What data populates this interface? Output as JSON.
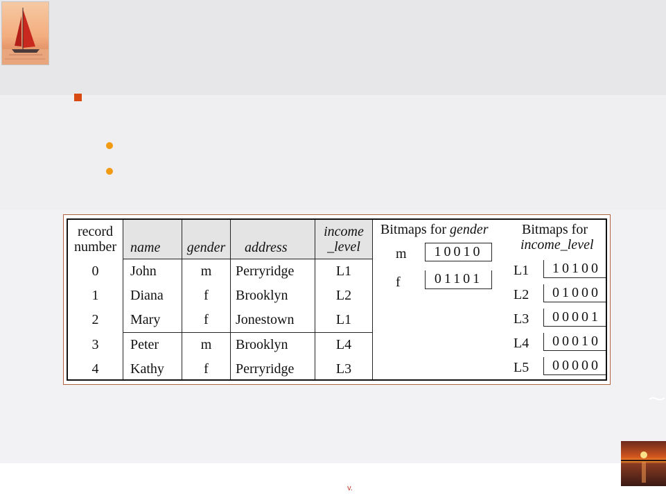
{
  "table": {
    "headers": {
      "record": "record",
      "record2": "number",
      "name": "name",
      "gender": "gender",
      "address": "address",
      "income": "income",
      "income2": "_level"
    },
    "rows": [
      {
        "record": "0",
        "name": "John",
        "gender": "m",
        "address": "Perryridge",
        "income_level": "L1"
      },
      {
        "record": "1",
        "name": "Diana",
        "gender": "f",
        "address": "Brooklyn",
        "income_level": "L2"
      },
      {
        "record": "2",
        "name": "Mary",
        "gender": "f",
        "address": "Jonestown",
        "income_level": "L1"
      },
      {
        "record": "3",
        "name": "Peter",
        "gender": "m",
        "address": "Brooklyn",
        "income_level": "L4"
      },
      {
        "record": "4",
        "name": "Kathy",
        "gender": "f",
        "address": "Perryridge",
        "income_level": "L3"
      }
    ]
  },
  "gender_bitmaps": {
    "title_prefix": "Bitmaps for ",
    "title_field": "gender",
    "items": [
      {
        "label": "m",
        "bits": "10010"
      },
      {
        "label": "f",
        "bits": "01101"
      }
    ]
  },
  "income_bitmaps": {
    "title_line1": "Bitmaps for",
    "title_line2": "income_level",
    "items": [
      {
        "label": "L1",
        "bits": "10100"
      },
      {
        "label": "L2",
        "bits": "01000"
      },
      {
        "label": "L3",
        "bits": "00001"
      },
      {
        "label": "L4",
        "bits": "00010"
      },
      {
        "label": "L5",
        "bits": "00000"
      }
    ]
  },
  "footer": {
    "mark": "v."
  },
  "colors": {
    "bullet_square": "#d84a12",
    "bullet_dot": "#f29a12",
    "figure_border": "#b5613f"
  }
}
